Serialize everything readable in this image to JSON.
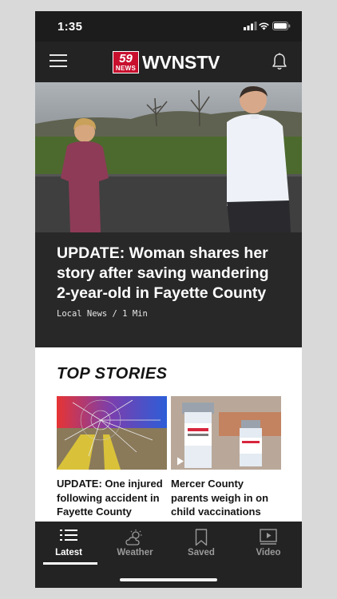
{
  "status_bar": {
    "time": "1:35"
  },
  "header": {
    "logo_number": "59",
    "logo_news": "NEWS",
    "logo_text": "WVNSTV"
  },
  "hero": {
    "headline": "UPDATE: Woman shares her story after saving wandering 2-year-old in Fayette County",
    "meta": "Local News / 1 Min"
  },
  "top_stories": {
    "title": "TOP STORIES",
    "items": [
      {
        "title": "UPDATE: One injured following accident in Fayette County"
      },
      {
        "title": "Mercer County parents weigh in on child vaccinations"
      }
    ]
  },
  "tab_bar": {
    "tabs": [
      {
        "label": "Latest",
        "icon": "list-icon",
        "active": true
      },
      {
        "label": "Weather",
        "icon": "weather-icon",
        "active": false
      },
      {
        "label": "Saved",
        "icon": "bookmark-icon",
        "active": false
      },
      {
        "label": "Video",
        "icon": "video-icon",
        "active": false
      }
    ]
  },
  "colors": {
    "brand_red": "#c8102e",
    "dark_bg": "#232323"
  }
}
